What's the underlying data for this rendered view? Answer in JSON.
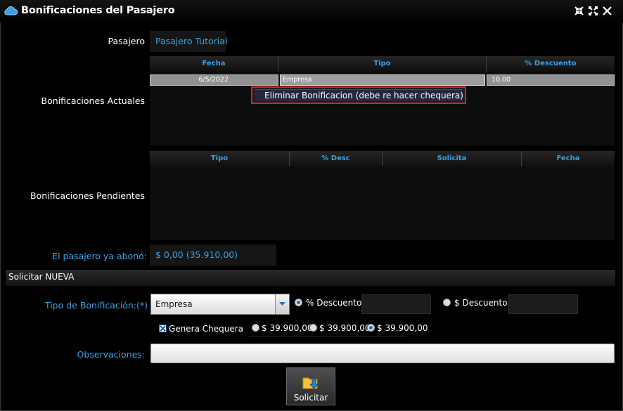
{
  "window": {
    "title": "Bonificaciones del Pasajero",
    "icons": [
      "cloud-icon",
      "minimize-icon",
      "maximize-icon",
      "close-icon"
    ]
  },
  "passenger": {
    "label": "Pasajero",
    "value": "Pasajero Tutorial"
  },
  "current_bonuses": {
    "label": "Bonificaciones Actuales",
    "columns": [
      "Fecha",
      "Tipo",
      "% Descuento"
    ],
    "rows": [
      {
        "fecha": "6/5/2022",
        "tipo": "Empresa",
        "descuento": "10,00"
      }
    ]
  },
  "context_menu": {
    "items": [
      "Eliminar Bonificacion (debe re hacer chequera)"
    ]
  },
  "pending_bonuses": {
    "label": "Bonificaciones Pendientes",
    "columns": [
      "Tipo",
      "% Desc",
      "Solicita",
      "Fecha"
    ]
  },
  "paid": {
    "label": "El pasajero ya abonó:",
    "value": "$ 0,00 (35.910,00)"
  },
  "new_request": {
    "section_title": "Solicitar NUEVA",
    "type_label": "Tipo de Bonificación:(*)",
    "type_value": "Empresa",
    "pct_discount_label": "% Descuento",
    "pct_discount_selected": true,
    "amount_discount_label": "$ Descuento",
    "checkbox_label": "Genera Chequera",
    "checkbox_checked": true,
    "price_options": [
      "$ 39.900,00",
      "$ 39.900,00",
      "$ 39.900,00"
    ],
    "price_selected_index": 2,
    "observations_label": "Observaciones:",
    "submit_label": "Solicitar"
  },
  "colors": {
    "accent": "#39a3e6",
    "highlight_border": "#e0201b",
    "background": "#000000"
  }
}
